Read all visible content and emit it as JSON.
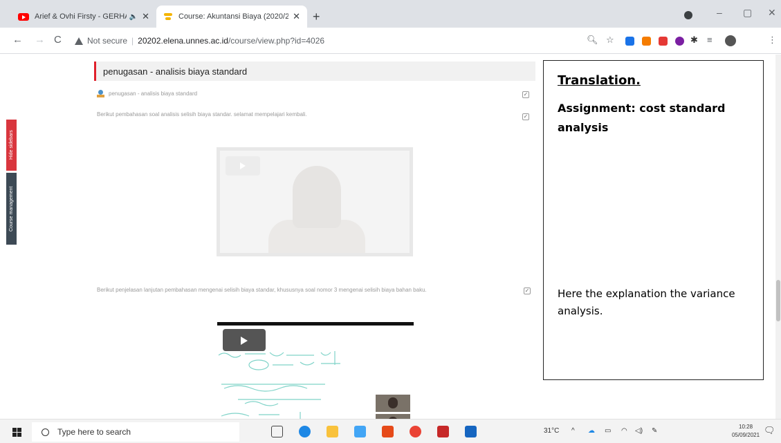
{
  "browser": {
    "tabs": [
      {
        "title": "Arief & Ovhi Firsty - GERHA",
        "active": false
      },
      {
        "title": "Course: Akuntansi Biaya (2020/2",
        "active": true
      }
    ],
    "new_tab": "+",
    "window_controls": {
      "minimize": "–",
      "maximize": "▢",
      "close": "✕"
    },
    "nav": {
      "back": "←",
      "forward": "→",
      "reload": "C"
    },
    "address": {
      "security": "Not secure",
      "host": "20202.elena.unnes.ac.id",
      "path": "/course/view.php?id=4026"
    }
  },
  "page": {
    "section_title": "penugasan - analisis biaya standard",
    "activity_link": "penugasan - analisis biaya standard",
    "label_1": "Berikut pembahasan soal analisis selisih biaya standar. selamat mempelajari kembali.",
    "label_2": "Berikut penjelasan lanjutan pembahasan mengenai selisih biaya standar, khususnya soal nomor 3 mengenai selisih biaya bahan baku.",
    "side_buttons": {
      "hide": "Hide sidebars",
      "manage": "Course management"
    }
  },
  "translation": {
    "title": "Translation.",
    "subtitle": "Assignment: cost standard analysis",
    "text": "Here the explanation the variance analysis."
  },
  "taskbar": {
    "search_placeholder": "Type here to search",
    "weather": "31°C",
    "time": "10:28",
    "date": "05/09/2021"
  },
  "colors": {
    "accent_red": "#d9363e",
    "sidebar_dark": "#3d4a55",
    "tab_strip": "#dee1e6"
  }
}
